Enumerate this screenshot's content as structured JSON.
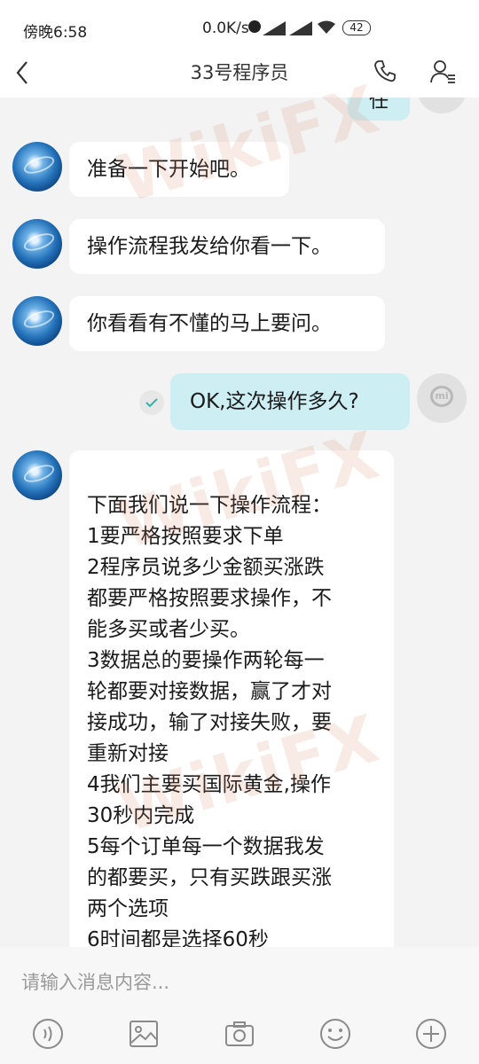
{
  "status_bar": {
    "time": "傍晚6:58",
    "net_speed": "0.0K/s",
    "battery": "42",
    "icons": [
      "alarm-icon",
      "signal-icon",
      "signal-icon",
      "wifi-icon",
      "battery-icon"
    ]
  },
  "header": {
    "title": "33号程序员",
    "icons": [
      "back-icon",
      "phone-icon",
      "contact-info-icon"
    ]
  },
  "messages": [
    {
      "from": "other",
      "text": "准备一下开始吧。"
    },
    {
      "from": "other",
      "text": "操作流程我发给你看一下。"
    },
    {
      "from": "other",
      "text": "你看看有不懂的马上要问。"
    },
    {
      "from": "me",
      "text": "OK,这次操作多久?"
    },
    {
      "from": "other",
      "text": "下面我们说一下操作流程：\n1要严格按照要求下单\n2程序员说多少金额买涨跌\n都要严格按照要求操作，不\n能多买或者少买。\n3数据总的要操作两轮每一\n轮都要对接数据，赢了才对\n接成功，输了对接失败，要\n重新对接\n4我们主要买国际黄金,操作\n30秒内完成\n5每个订单每一个数据我发\n的都要买，只有买跌跟买涨\n两个选项\n6时间都是选择60秒"
    }
  ],
  "partial_bubble_text": "任",
  "input": {
    "placeholder": "请输入消息内容..."
  },
  "toolbar_icons": [
    "voice-icon",
    "image-icon",
    "camera-icon",
    "emoji-icon",
    "plus-icon"
  ],
  "watermark": "WikiFX",
  "colors": {
    "incoming_bubble": "#ffffff",
    "outgoing_bubble": "#cdeef2",
    "background": "#f3f3f3"
  }
}
